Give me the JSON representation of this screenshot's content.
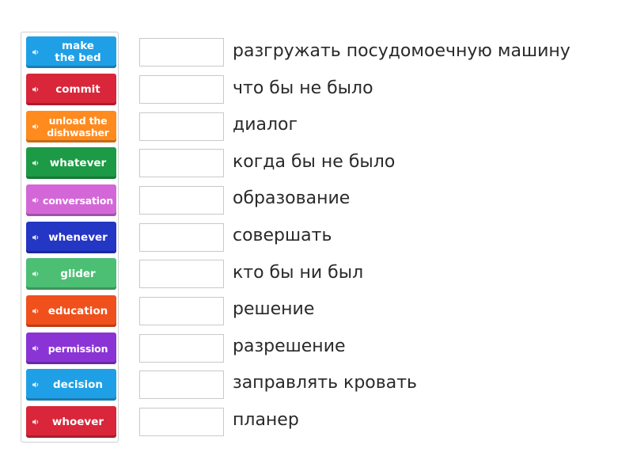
{
  "tiles": [
    {
      "label": "make\nthe bed",
      "color": "#1fa0e6"
    },
    {
      "label": "commit",
      "color": "#d9263a"
    },
    {
      "label": "unload the\ndishwasher",
      "color": "#ff8a1e"
    },
    {
      "label": "whatever",
      "color": "#1d9a45"
    },
    {
      "label": "conversation",
      "color": "#d367d8"
    },
    {
      "label": "whenever",
      "color": "#2436c4"
    },
    {
      "label": "glider",
      "color": "#4cbf74"
    },
    {
      "label": "education",
      "color": "#f0501c"
    },
    {
      "label": "permission",
      "color": "#8a34d6"
    },
    {
      "label": "decision",
      "color": "#1fa0e6"
    },
    {
      "label": "whoever",
      "color": "#d9263a"
    }
  ],
  "definitions": [
    "разгружать посудомоечную машину",
    "что бы не было",
    "диалог",
    "когда бы не было",
    "образование",
    "совершать",
    "кто бы ни был",
    "решение",
    "разрешение",
    "заправлять кровать",
    "планер"
  ],
  "icons": {
    "tile_audio": "speaker-icon"
  }
}
